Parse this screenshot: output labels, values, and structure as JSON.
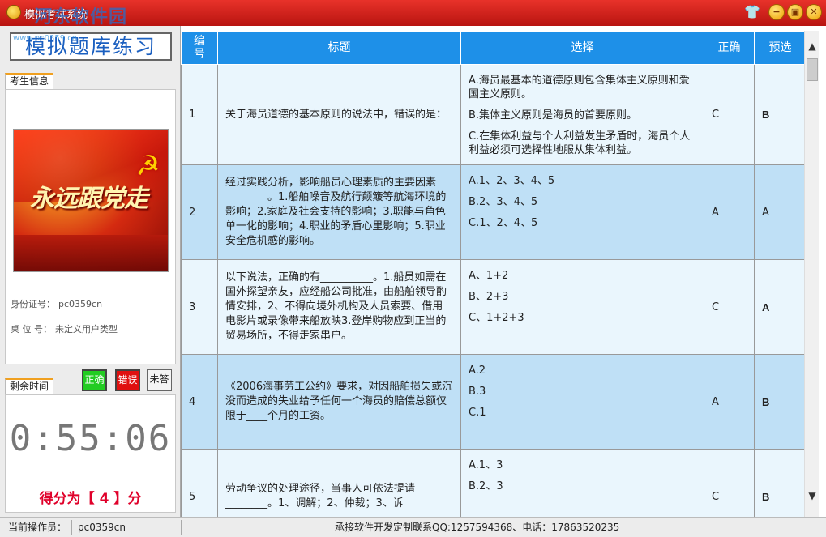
{
  "window": {
    "title": "模拟考试系统",
    "watermark": "河东软件园",
    "controls": [
      "skin-icon",
      "minimize-icon",
      "restore-icon",
      "close-icon"
    ]
  },
  "logo": {
    "text": "模拟题库练习",
    "watermark": "www.pc0359.cn"
  },
  "candidate": {
    "tab_label": "考生信息",
    "photo_slogan": "永远跟党走",
    "id_label": "身份证号：",
    "id_value": "pc0359cn",
    "seat_label": "桌 位 号：",
    "seat_value": "未定义用户类型"
  },
  "legend": {
    "correct": "正确",
    "wrong": "错误",
    "unanswered": "未答",
    "correct_color": "#22cc22",
    "wrong_color": "#e01010"
  },
  "timer": {
    "tab_label": "剩余时间",
    "value": "0:55:06"
  },
  "score": {
    "text": "得分为【 4 】分"
  },
  "table": {
    "headers": {
      "num": "编号",
      "title": "标题",
      "choices": "选择",
      "answer": "正确",
      "preselect": "预选"
    },
    "rows": [
      {
        "num": "1",
        "title": "关于海员道德的基本原则的说法中，错误的是：",
        "options": [
          "A.海员最基本的道德原则包含集体主义原则和爱国主义原则。",
          "B.集体主义原则是海员的首要原则。",
          "C.在集体利益与个人利益发生矛盾时，海员个人利益必须可选择性地服从集体利益。"
        ],
        "answer": "C",
        "preselect": "B",
        "preselect_big": true
      },
      {
        "num": "2",
        "title": "经过实践分析，影响船员心理素质的主要因素________。1.船舶噪音及航行颠簸等航海环境的影响；2.家庭及社会支持的影响；3.职能与角色单一化的影响；4.职业的矛盾心里影响；5.职业安全危机感的影响。",
        "options": [
          "A.1、2、3、4、5",
          "B.2、3、4、5",
          "C.1、2、4、5"
        ],
        "answer": "A",
        "preselect": "A",
        "preselect_big": false
      },
      {
        "num": "3",
        "title": "以下说法，正确的有__________。1.船员如需在国外探望亲友，应经船公司批准，由船舶领导酌情安排，2、不得向境外机构及人员索要、借用电影片或录像带来船放映3.登岸购物应到正当的贸易场所，不得走家串户。",
        "options": [
          "A、1+2",
          "B、2+3",
          "C、1+2+3"
        ],
        "answer": "C",
        "preselect": "A",
        "preselect_big": true
      },
      {
        "num": "4",
        "title": "《2006海事劳工公约》要求，对因船舶损失或沉没而造成的失业给予任何一个海员的赔偿总额仅限于____个月的工资。",
        "options": [
          "A.2",
          "B.3",
          "C.1"
        ],
        "answer": "A",
        "preselect": "B",
        "preselect_big": true
      },
      {
        "num": "5",
        "title": "劳动争议的处理途径，当事人可依法提请________。1、调解；2、仲裁；3、诉",
        "options": [
          "A.1、3",
          "B.2、3"
        ],
        "answer": "C",
        "preselect": "B",
        "preselect_big": true
      }
    ]
  },
  "statusbar": {
    "operator_label": "当前操作员：",
    "operator_value": "pc0359cn",
    "contact": "承接软件开发定制联系QQ:1257594368、电话：17863520235"
  }
}
